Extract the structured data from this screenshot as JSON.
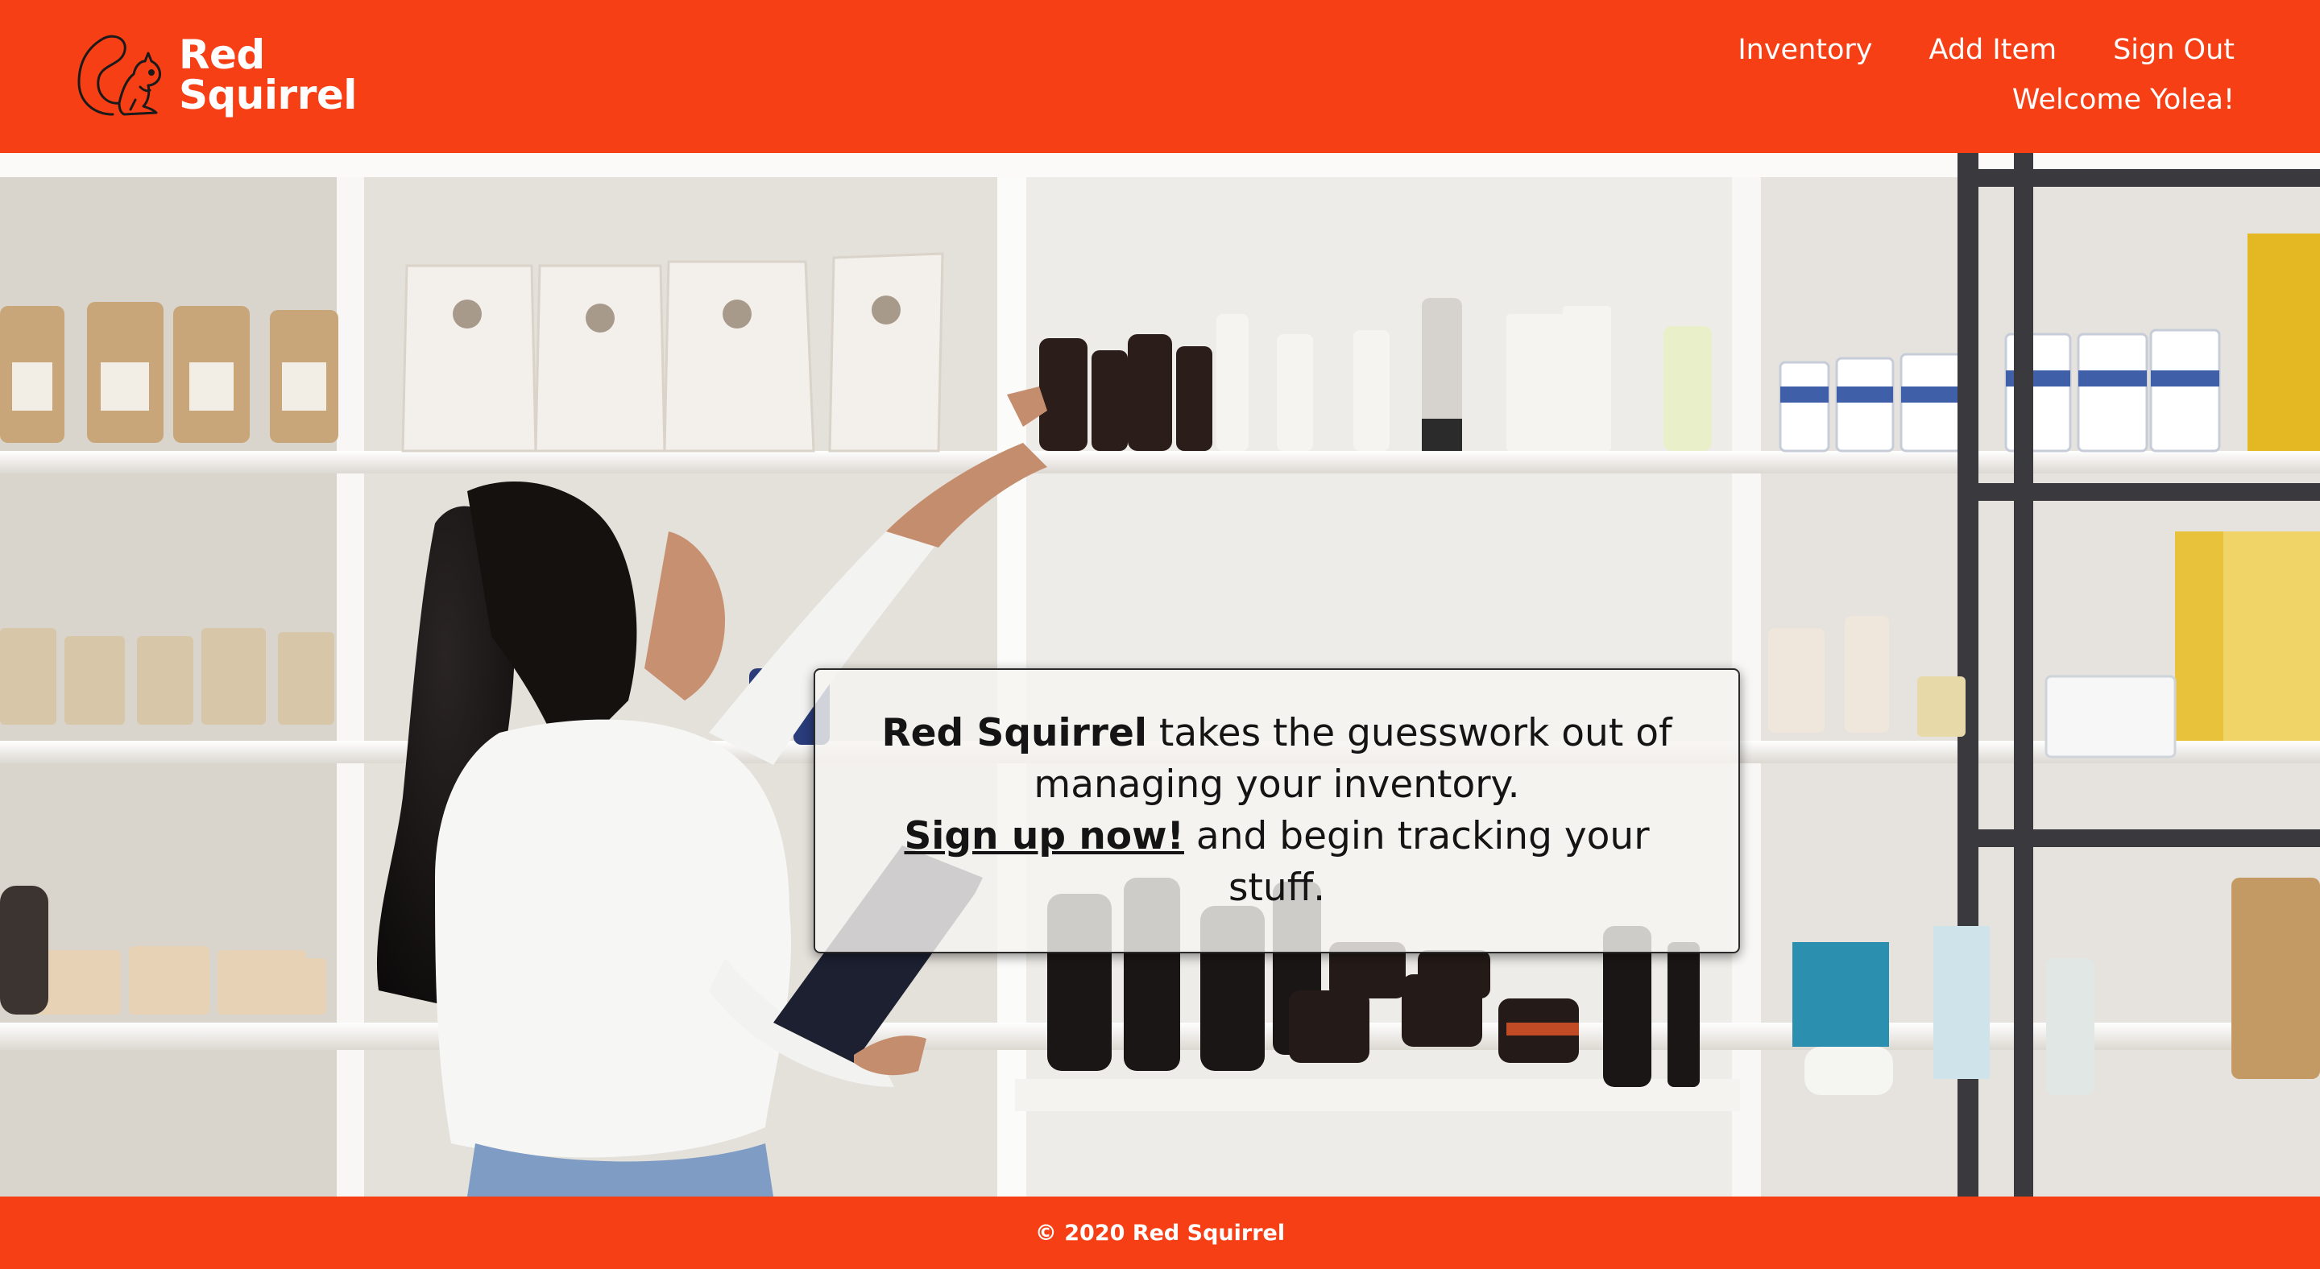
{
  "brand": {
    "line1": "Red",
    "line2": "Squirrel",
    "logo_icon": "squirrel-icon",
    "color": "#F73F16"
  },
  "nav": {
    "inventory": "Inventory",
    "add_item": "Add Item",
    "sign_out": "Sign Out",
    "welcome": "Welcome Yolea!"
  },
  "hero": {
    "image": "woman reaching for products on white retail shelves, holding a tablet",
    "promo": {
      "brand": "Red Squirrel",
      "text1": " takes the guesswork out of managing your inventory.",
      "link": "Sign up now!",
      "text2": " and begin tracking your stuff."
    }
  },
  "footer": {
    "copyright": "© 2020 Red Squirrel"
  }
}
